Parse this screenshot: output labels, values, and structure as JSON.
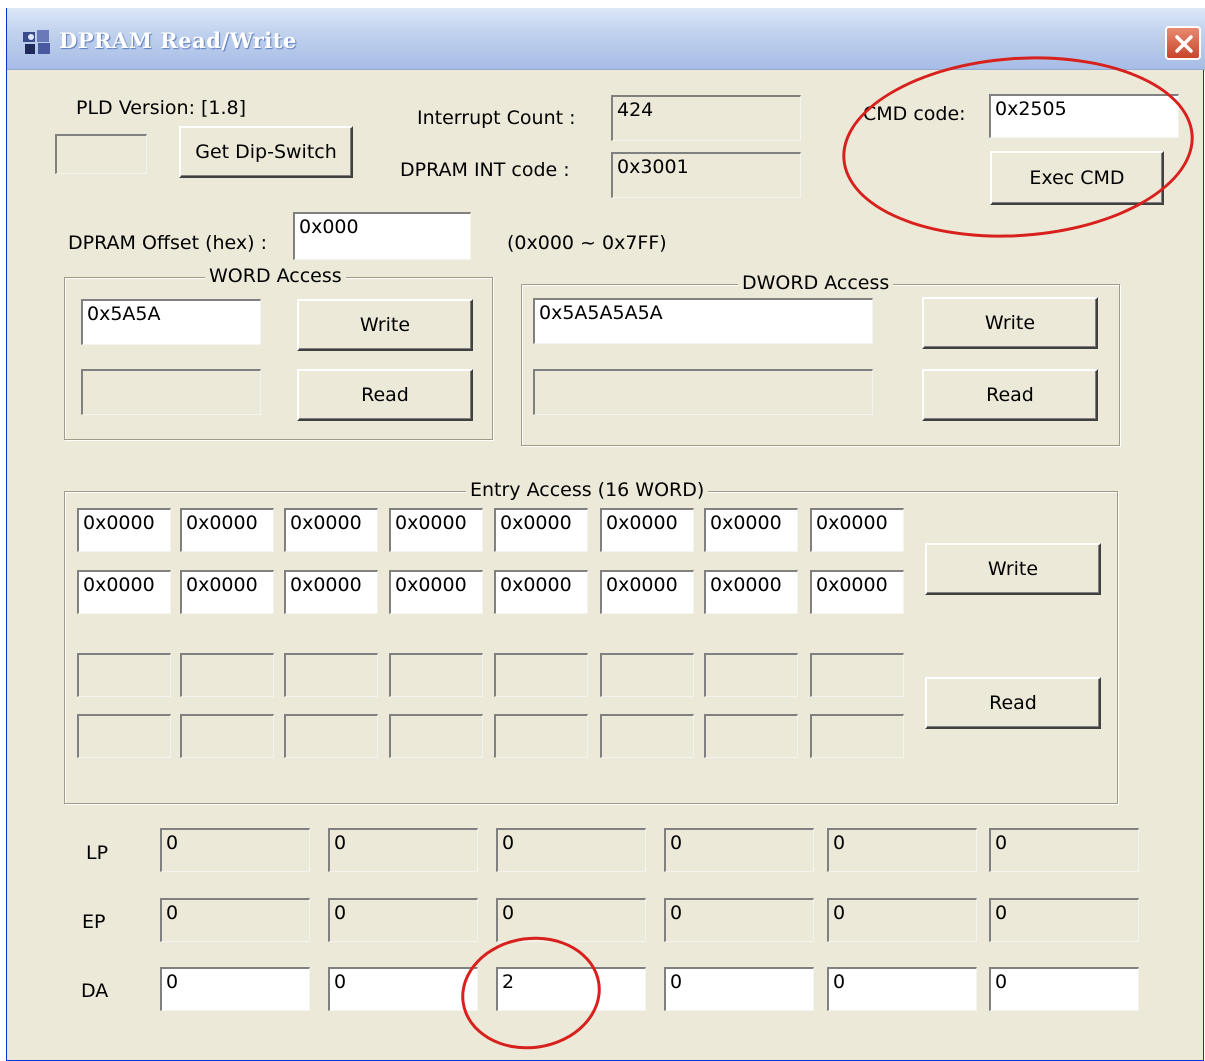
{
  "window": {
    "title": "DPRAM Read/Write",
    "icon": "app-icon",
    "close_icon": "close-icon"
  },
  "header": {
    "pld_version": "PLD Version: [1.8]",
    "dip_value": "",
    "get_dip_label": "Get Dip-Switch",
    "interrupt_count_label": "Interrupt Count :",
    "interrupt_count": "424",
    "int_code_label": "DPRAM INT code :",
    "int_code": "0x3001",
    "cmd_code_label": "CMD code:",
    "cmd_code": "0x2505",
    "exec_cmd_label": "Exec CMD"
  },
  "offset": {
    "label": "DPRAM Offset (hex) :",
    "value": "0x000",
    "range": "(0x000 ~ 0x7FF)"
  },
  "word_access": {
    "title": "WORD Access",
    "write_value": "0x5A5A",
    "read_value": "",
    "write_label": "Write",
    "read_label": "Read"
  },
  "dword_access": {
    "title": "DWORD Access",
    "write_value": "0x5A5A5A5A",
    "read_value": "",
    "write_label": "Write",
    "read_label": "Read"
  },
  "entry_access": {
    "title": "Entry Access (16 WORD)",
    "write_row1": [
      "0x0000",
      "0x0000",
      "0x0000",
      "0x0000",
      "0x0000",
      "0x0000",
      "0x0000",
      "0x0000"
    ],
    "write_row2": [
      "0x0000",
      "0x0000",
      "0x0000",
      "0x0000",
      "0x0000",
      "0x0000",
      "0x0000",
      "0x0000"
    ],
    "read_row1": [
      "",
      "",
      "",
      "",
      "",
      "",
      "",
      ""
    ],
    "read_row2": [
      "",
      "",
      "",
      "",
      "",
      "",
      "",
      ""
    ],
    "write_label": "Write",
    "read_label": "Read"
  },
  "params": {
    "lp_label": "LP",
    "lp": [
      "0",
      "0",
      "0",
      "0",
      "0",
      "0"
    ],
    "ep_label": "EP",
    "ep": [
      "0",
      "0",
      "0",
      "0",
      "0",
      "0"
    ],
    "da_label": "DA",
    "da": [
      "0",
      "0",
      "2",
      "0",
      "0",
      "0"
    ]
  },
  "colors": {
    "annotation": "#d8201c",
    "dialog_bg": "#ece9d8",
    "title_text": "#ffffff"
  }
}
